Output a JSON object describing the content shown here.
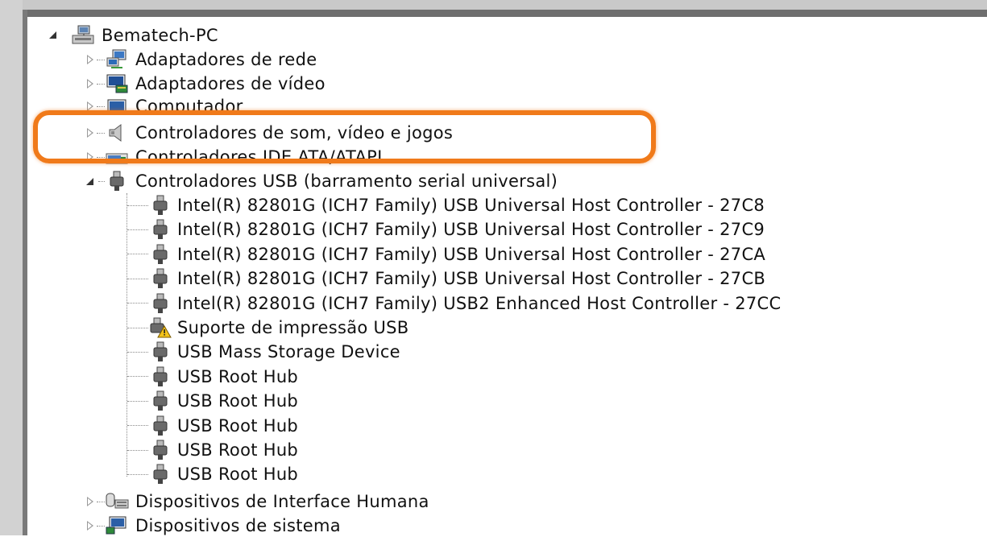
{
  "tree": {
    "root": {
      "label": "Bematech-PC",
      "icon": "computer-network-icon",
      "expanded": true
    },
    "categories_top": [
      {
        "label": "Adaptadores de rede",
        "icon": "network-adapter-icon"
      },
      {
        "label": "Adaptadores de vídeo",
        "icon": "display-adapter-icon"
      },
      {
        "label": "Computador",
        "icon": "computer-icon"
      },
      {
        "label": "Controladores de som, vídeo e jogos",
        "icon": "speaker-icon"
      },
      {
        "label": "Controladores IDE ATA/ATAPI",
        "icon": "ide-controller-icon"
      }
    ],
    "usb_category": {
      "label": "Controladores USB (barramento serial universal)",
      "icon": "usb-plug-icon",
      "expanded": true
    },
    "usb_devices": [
      {
        "label": "Intel(R) 82801G (ICH7 Family) USB Universal Host Controller - 27C8",
        "icon": "usb-plug-icon"
      },
      {
        "label": "Intel(R) 82801G (ICH7 Family) USB Universal Host Controller - 27C9",
        "icon": "usb-plug-icon"
      },
      {
        "label": "Intel(R) 82801G (ICH7 Family) USB Universal Host Controller - 27CA",
        "icon": "usb-plug-icon"
      },
      {
        "label": "Intel(R) 82801G (ICH7 Family) USB Universal Host Controller - 27CB",
        "icon": "usb-plug-icon"
      },
      {
        "label": "Intel(R) 82801G (ICH7 Family) USB2 Enhanced Host Controller - 27CC",
        "icon": "usb-plug-icon"
      },
      {
        "label": "Suporte de impressão USB",
        "icon": "usb-warning-icon"
      },
      {
        "label": "USB Mass Storage Device",
        "icon": "usb-plug-icon"
      },
      {
        "label": "USB Root Hub",
        "icon": "usb-plug-icon"
      },
      {
        "label": "USB Root Hub",
        "icon": "usb-plug-icon"
      },
      {
        "label": "USB Root Hub",
        "icon": "usb-plug-icon"
      },
      {
        "label": "USB Root Hub",
        "icon": "usb-plug-icon"
      },
      {
        "label": "USB Root Hub",
        "icon": "usb-plug-icon"
      }
    ],
    "categories_bottom": [
      {
        "label": "Dispositivos de Interface Humana",
        "icon": "hid-icon"
      },
      {
        "label": "Dispositivos de sistema",
        "icon": "system-devices-icon"
      }
    ]
  },
  "colors": {
    "highlight": "#f07a1a",
    "text": "#111111",
    "background": "#ffffff"
  }
}
